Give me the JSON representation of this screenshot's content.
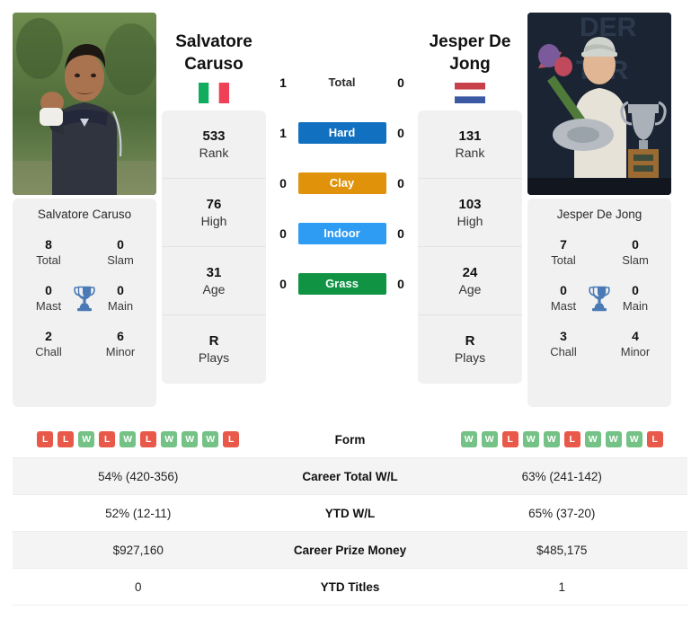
{
  "players": {
    "left": {
      "name_display": "Salvatore\nCaruso",
      "name_line1": "Salvatore",
      "name_line2": "Caruso",
      "caption_name": "Salvatore Caruso",
      "country": "Italy",
      "flag_icon": "flag-italy",
      "photo_alt": "Salvatore Caruso photo",
      "rank": {
        "value": "533",
        "label": "Rank"
      },
      "high": {
        "value": "76",
        "label": "High"
      },
      "age": {
        "value": "31",
        "label": "Age"
      },
      "plays": {
        "value": "R",
        "label": "Plays"
      },
      "titles": {
        "total": {
          "value": "8",
          "label": "Total"
        },
        "slam": {
          "value": "0",
          "label": "Slam"
        },
        "mast": {
          "value": "0",
          "label": "Mast"
        },
        "main": {
          "value": "0",
          "label": "Main"
        },
        "chall": {
          "value": "2",
          "label": "Chall"
        },
        "minor": {
          "value": "6",
          "label": "Minor"
        }
      },
      "form": [
        "L",
        "L",
        "W",
        "L",
        "W",
        "L",
        "W",
        "W",
        "W",
        "L"
      ],
      "career_total_wl": "54% (420-356)",
      "ytd_wl": "52% (12-11)",
      "career_prize_money": "$927,160",
      "ytd_titles": "0"
    },
    "right": {
      "name_display": "Jesper De\nJong",
      "name_line1": "Jesper De",
      "name_line2": "Jong",
      "caption_name": "Jesper De Jong",
      "country": "Netherlands",
      "flag_icon": "flag-netherlands",
      "photo_alt": "Jesper De Jong photo",
      "rank": {
        "value": "131",
        "label": "Rank"
      },
      "high": {
        "value": "103",
        "label": "High"
      },
      "age": {
        "value": "24",
        "label": "Age"
      },
      "plays": {
        "value": "R",
        "label": "Plays"
      },
      "titles": {
        "total": {
          "value": "7",
          "label": "Total"
        },
        "slam": {
          "value": "0",
          "label": "Slam"
        },
        "mast": {
          "value": "0",
          "label": "Mast"
        },
        "main": {
          "value": "0",
          "label": "Main"
        },
        "chall": {
          "value": "3",
          "label": "Chall"
        },
        "minor": {
          "value": "4",
          "label": "Minor"
        }
      },
      "form": [
        "W",
        "W",
        "L",
        "W",
        "W",
        "L",
        "W",
        "W",
        "W",
        "L"
      ],
      "career_total_wl": "63% (241-142)",
      "ytd_wl": "65% (37-20)",
      "career_prize_money": "$485,175",
      "ytd_titles": "1"
    }
  },
  "head_to_head": {
    "rows": [
      {
        "label": "Total",
        "left": "1",
        "right": "0",
        "badge": false,
        "color": ""
      },
      {
        "label": "Hard",
        "left": "1",
        "right": "0",
        "badge": true,
        "color": "#1270c0"
      },
      {
        "label": "Clay",
        "left": "0",
        "right": "0",
        "badge": true,
        "color": "#e0930a"
      },
      {
        "label": "Indoor",
        "left": "0",
        "right": "0",
        "badge": true,
        "color": "#2f9cf4"
      },
      {
        "label": "Grass",
        "left": "0",
        "right": "0",
        "badge": true,
        "color": "#109444"
      }
    ]
  },
  "stats_table": {
    "rows": [
      {
        "key": "form",
        "label": "Form",
        "type": "form"
      },
      {
        "key": "career_wl",
        "label": "Career Total W/L",
        "type": "text",
        "left": "54% (420-356)",
        "right": "63% (241-142)"
      },
      {
        "key": "ytd_wl",
        "label": "YTD W/L",
        "type": "text",
        "left": "52% (12-11)",
        "right": "65% (37-20)"
      },
      {
        "key": "prize",
        "label": "Career Prize Money",
        "type": "text",
        "left": "$927,160",
        "right": "$485,175"
      },
      {
        "key": "ytd_titles",
        "label": "YTD Titles",
        "type": "text",
        "left": "0",
        "right": "1"
      }
    ]
  },
  "colors": {
    "win": "#74c285",
    "loss": "#e8594a",
    "hard": "#1270c0",
    "clay": "#e0930a",
    "indoor": "#2f9cf4",
    "grass": "#109444",
    "trophy": "#4a7ab5",
    "card_bg": "#f1f1f1",
    "row_alt": "#f4f4f4"
  }
}
